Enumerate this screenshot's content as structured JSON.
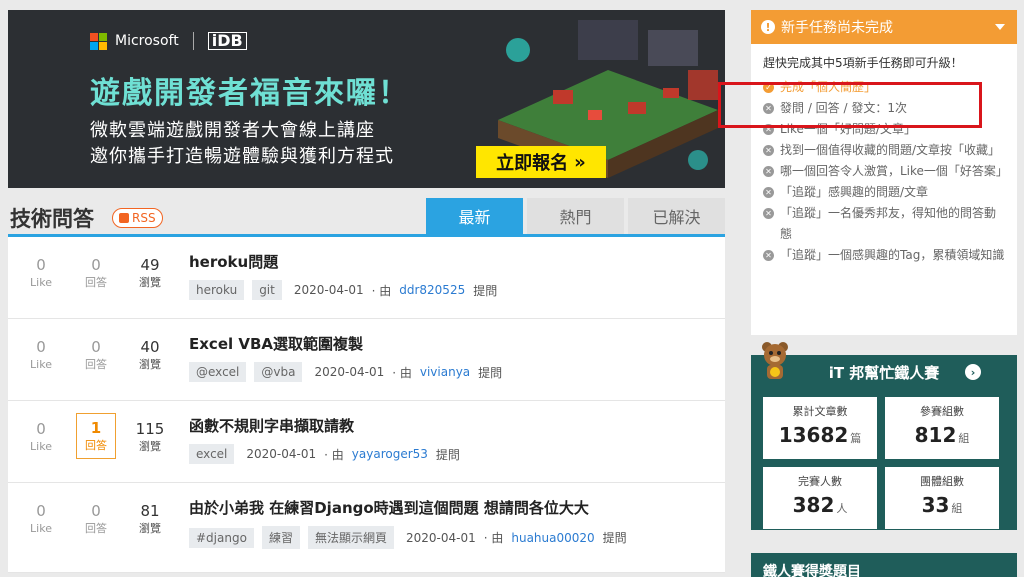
{
  "banner": {
    "logo_ms": "Microsoft",
    "logo_idb": "iDB",
    "title": "遊戲開發者福音來囉！",
    "sub1": "微軟雲端遊戲開發者大會線上講座",
    "sub2": "邀你攜手打造暢遊體驗與獲利方程式",
    "cta": "立即報名",
    "cta_arrow": "»"
  },
  "section": {
    "title": "技術問答",
    "rss": "RSS"
  },
  "tabs": [
    {
      "label": "最新"
    },
    {
      "label": "熱門"
    },
    {
      "label": "已解決"
    }
  ],
  "labels": {
    "likes": "Like",
    "answers": "回答",
    "views": "瀏覽",
    "by": "· 由",
    "asked": "提問"
  },
  "questions": [
    {
      "likes": "0",
      "answers": "0",
      "views": "49",
      "title": "heroku問題",
      "tags": [
        "heroku",
        "git"
      ],
      "date": "2020-04-01",
      "user": "ddr820525"
    },
    {
      "likes": "0",
      "answers": "0",
      "views": "40",
      "title": "Excel VBA選取範圍複製",
      "tags": [
        "@excel",
        "@vba"
      ],
      "date": "2020-04-01",
      "user": "vivianya"
    },
    {
      "likes": "0",
      "answers": "1",
      "views": "115",
      "title": "函數不規則字串擷取請教",
      "tags": [
        "excel"
      ],
      "date": "2020-04-01",
      "user": "yayaroger53"
    },
    {
      "likes": "0",
      "answers": "0",
      "views": "81",
      "title": "由於小弟我 在練習Django時遇到這個問題 想請問各位大大",
      "tags": [
        "#django",
        "練習",
        "無法顯示網頁"
      ],
      "date": "2020-04-01",
      "user": "huahua00020"
    }
  ],
  "task": {
    "header": "新手任務尚未完成",
    "intro": "趕快完成其中5項新手任務即可升級！",
    "items": [
      {
        "text": "完成「個人簡歷」",
        "done": true
      },
      {
        "text": "發問 / 回答 / 發文：1次",
        "done": false
      },
      {
        "text": "Like一個「好問題/文章」",
        "done": false
      },
      {
        "text": "找到一個值得收藏的問題/文章按「收藏」",
        "done": false
      },
      {
        "text": "哪一個回答令人激賞，Like一個「好答案」",
        "done": false
      },
      {
        "text": "「追蹤」感興趣的問題/文章",
        "done": false
      },
      {
        "text": "「追蹤」一名優秀邦友，得知他的問答動態",
        "done": false
      },
      {
        "text": "「追蹤」一個感興趣的Tag，累積領域知識",
        "done": false
      }
    ]
  },
  "iron": {
    "title": "iT 邦幫忙鐵人賽",
    "stats": [
      {
        "label": "累計文章數",
        "value": "13682",
        "unit": "篇"
      },
      {
        "label": "參賽組數",
        "value": "812",
        "unit": "組"
      },
      {
        "label": "完賽人數",
        "value": "382",
        "unit": "人"
      },
      {
        "label": "團體組數",
        "value": "33",
        "unit": "組"
      }
    ]
  },
  "award": {
    "title": "鐵人賽得獎題目"
  },
  "colors": {
    "accent": "#2ba3e1",
    "orange": "#f39c34",
    "teal": "#1f5d5a",
    "highlight_red": "#d9151b"
  }
}
